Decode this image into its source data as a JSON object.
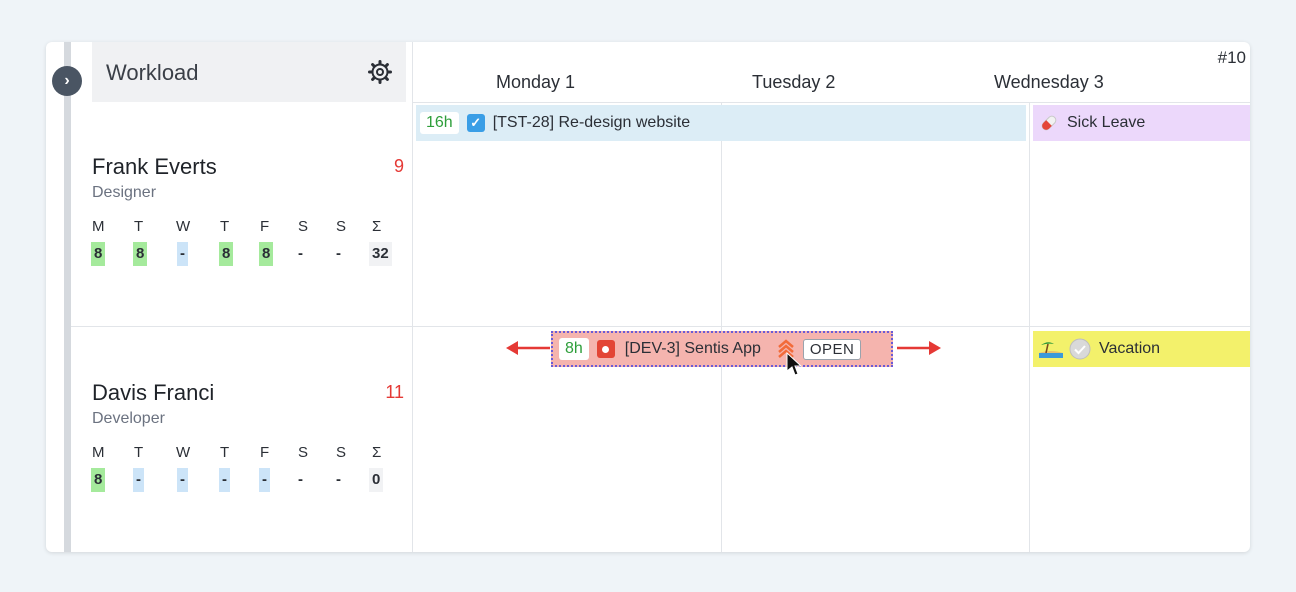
{
  "sidebar": {
    "title": "Workload",
    "toggle_icon": "chevron-right-icon",
    "settings_icon": "gear-icon"
  },
  "calendar": {
    "week_label": "#10",
    "days": [
      "Monday 1",
      "Tuesday 2",
      "Wednesday 3"
    ]
  },
  "people": [
    {
      "name": "Frank Everts",
      "role": "Designer",
      "count": "9",
      "day_labels": [
        "M",
        "T",
        "W",
        "T",
        "F",
        "S",
        "S",
        "Σ"
      ],
      "day_values": [
        "8",
        "8",
        "-",
        "8",
        "8",
        "-",
        "-",
        "32"
      ]
    },
    {
      "name": "Davis Franci",
      "role": "Developer",
      "count": "11",
      "day_labels": [
        "M",
        "T",
        "W",
        "T",
        "F",
        "S",
        "S",
        "Σ"
      ],
      "day_values": [
        "8",
        "-",
        "-",
        "-",
        "-",
        "-",
        "-",
        "0"
      ]
    }
  ],
  "bars": {
    "task1": {
      "hours": "16h",
      "label": "[TST-28] Re-design website",
      "icon": "checkbox-icon"
    },
    "sick": {
      "label": "Sick Leave",
      "icon": "pill-icon"
    },
    "task2": {
      "hours": "8h",
      "label": "[DEV-3] Sentis App",
      "status": "OPEN",
      "icon": "bug-icon",
      "priority_icon": "priority-highest-icon"
    },
    "vacation": {
      "label": "Vacation",
      "icon": "beach-icon",
      "status_icon": "check-circle-icon"
    }
  },
  "colors": {
    "task1_bg": "#dcedf6",
    "sick_bg": "#ecd8fb",
    "task2_bg": "#f5b4ae",
    "vacation_bg": "#f3f16b",
    "count_red": "#e53935",
    "value_green": "#a5ea9c",
    "value_blue": "#cce4f8"
  }
}
